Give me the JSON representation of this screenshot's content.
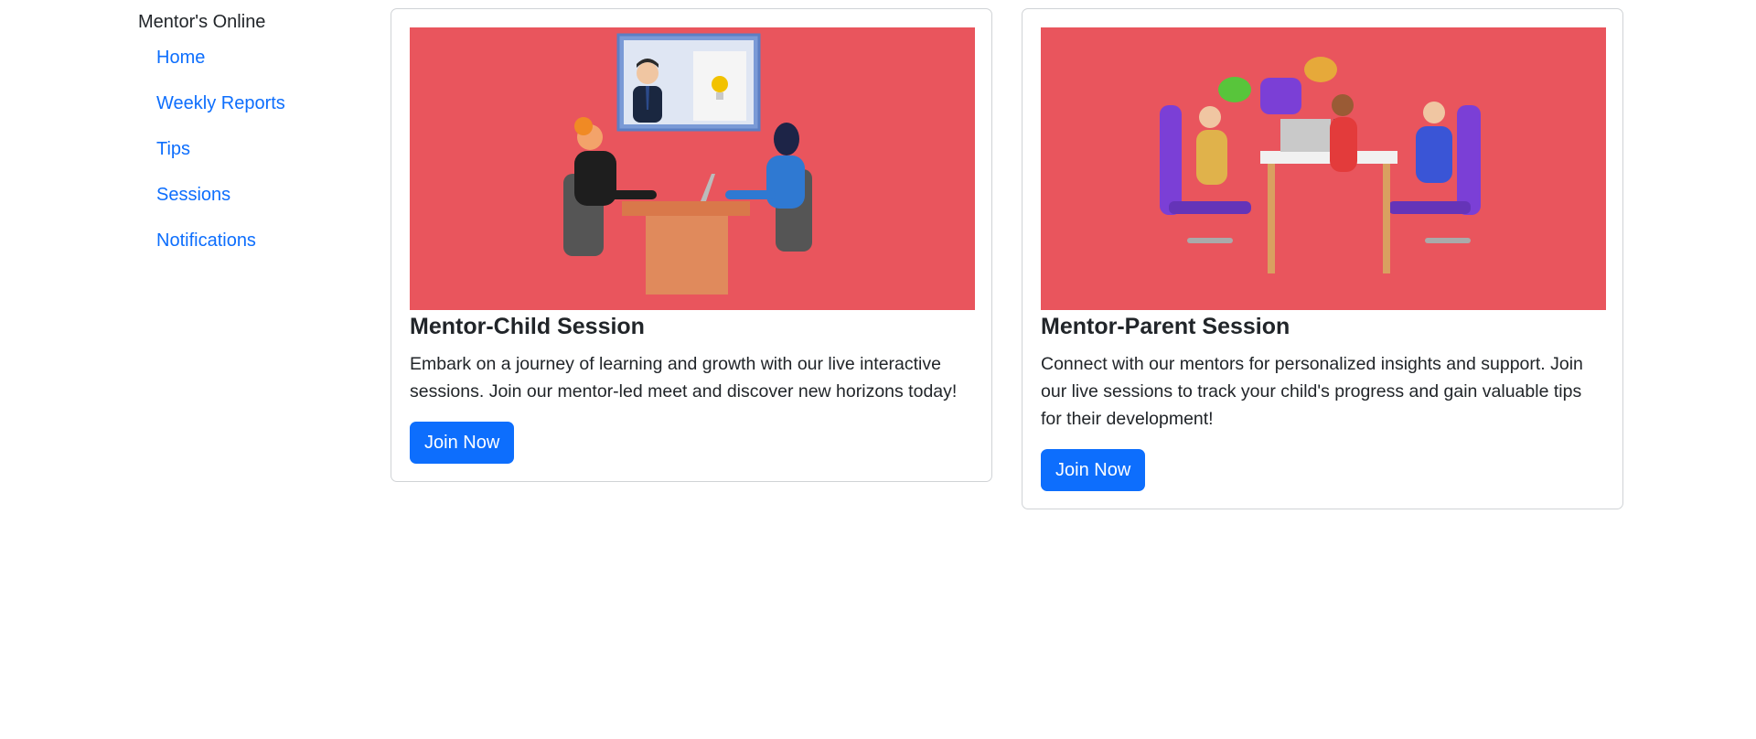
{
  "sidebar": {
    "brand": "Mentor's Online",
    "items": [
      {
        "label": "Home"
      },
      {
        "label": "Weekly Reports"
      },
      {
        "label": "Tips"
      },
      {
        "label": "Sessions"
      },
      {
        "label": "Notifications"
      }
    ]
  },
  "cards": [
    {
      "title": "Mentor-Child Session",
      "text": "Embark on a journey of learning and growth with our live interactive sessions. Join our mentor-led meet and discover new horizons today!",
      "button": "Join Now"
    },
    {
      "title": "Mentor-Parent Session",
      "text": "Connect with our mentors for personalized insights and support. Join our live sessions to track your child's progress and gain valuable tips for their development!",
      "button": "Join Now"
    }
  ],
  "colors": {
    "accent": "#0d6efd",
    "image_background": "#e9555d"
  }
}
